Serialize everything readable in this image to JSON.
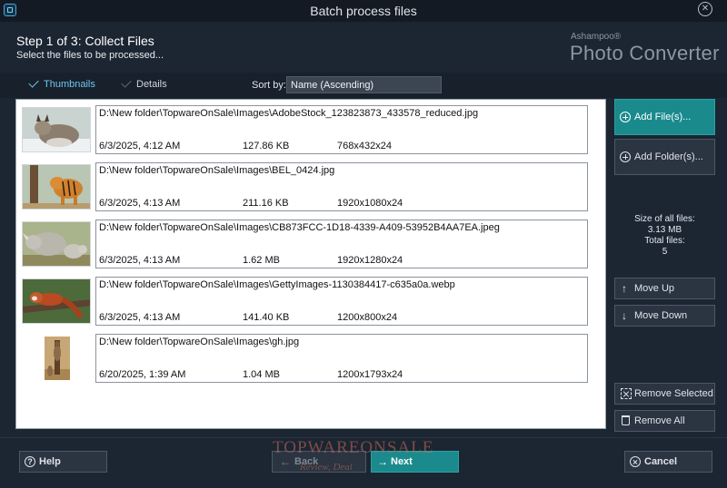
{
  "window": {
    "title": "Batch process files"
  },
  "header": {
    "step_title": "Step 1 of 3: Collect Files",
    "step_subtitle": "Select the files to be processed...",
    "brand_small": "Ashampoo®",
    "brand_big": "Photo Converter"
  },
  "view": {
    "thumbnails_label": "Thumbnails",
    "details_label": "Details",
    "sort_label": "Sort by:",
    "sort_value": "Name (Ascending)"
  },
  "files": [
    {
      "path": "D:\\New folder\\TopwareOnSale\\Images\\AdobeStock_123823873_433578_reduced.jpg",
      "date": "6/3/2025, 4:12 AM",
      "size": "127.86 KB",
      "dims": "768x432x24",
      "subject": "lynx"
    },
    {
      "path": "D:\\New folder\\TopwareOnSale\\Images\\BEL_0424.jpg",
      "date": "6/3/2025, 4:13 AM",
      "size": "211.16 KB",
      "dims": "1920x1080x24",
      "subject": "tiger"
    },
    {
      "path": "D:\\New folder\\TopwareOnSale\\Images\\CB873FCC-1D18-4339-A409-53952B4AA7EA.jpeg",
      "date": "6/3/2025, 4:13 AM",
      "size": "1.62 MB",
      "dims": "1920x1280x24",
      "subject": "rhino"
    },
    {
      "path": "D:\\New folder\\TopwareOnSale\\Images\\GettyImages-1130384417-c635a0a.webp",
      "date": "6/3/2025, 4:13 AM",
      "size": "141.40 KB",
      "dims": "1200x800x24",
      "subject": "red-panda"
    },
    {
      "path": "D:\\New folder\\TopwareOnSale\\Images\\gh.jpg",
      "date": "6/20/2025, 1:39 AM",
      "size": "1.04 MB",
      "dims": "1200x1793x24",
      "subject": "meerkat"
    }
  ],
  "side": {
    "add_files": "Add File(s)...",
    "add_folder": "Add Folder(s)...",
    "size_label": "Size of all files:",
    "size_value": "3.13 MB",
    "total_label": "Total files:",
    "total_value": "5",
    "move_up": "Move Up",
    "move_down": "Move Down",
    "remove_selected": "Remove Selected",
    "remove_all": "Remove All"
  },
  "footer": {
    "help": "Help",
    "back": "Back",
    "next": "Next",
    "cancel": "Cancel"
  },
  "watermark": {
    "main": "TOPWAREONSALE",
    "sub": "Review, Deal"
  },
  "colors": {
    "accent": "#1a8a8d",
    "background": "#1c2532",
    "link": "#6ec7f0"
  }
}
